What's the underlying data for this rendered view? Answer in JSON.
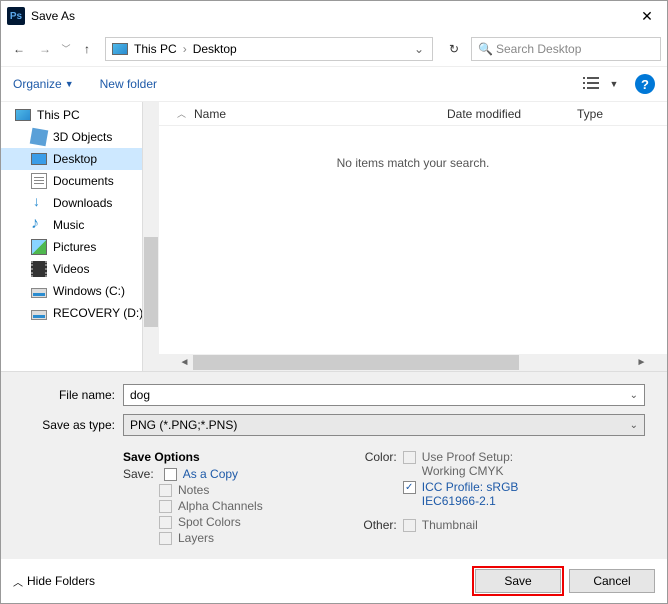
{
  "window": {
    "title": "Save As"
  },
  "breadcrumb": {
    "root": "This PC",
    "current": "Desktop"
  },
  "search": {
    "placeholder": "Search Desktop"
  },
  "toolbar": {
    "organize": "Organize",
    "new_folder": "New folder"
  },
  "tree": {
    "this_pc": "This PC",
    "objects_3d": "3D Objects",
    "desktop": "Desktop",
    "documents": "Documents",
    "downloads": "Downloads",
    "music": "Music",
    "pictures": "Pictures",
    "videos": "Videos",
    "drive_c": "Windows (C:)",
    "drive_d": "RECOVERY (D:)"
  },
  "columns": {
    "name": "Name",
    "date": "Date modified",
    "type": "Type"
  },
  "empty_message": "No items match your search.",
  "form": {
    "filename_label": "File name:",
    "filename_value": "dog",
    "type_label": "Save as type:",
    "type_value": "PNG (*.PNG;*.PNS)"
  },
  "options": {
    "heading": "Save Options",
    "save_label": "Save:",
    "as_copy": "As a Copy",
    "notes": "Notes",
    "alpha": "Alpha Channels",
    "spot": "Spot Colors",
    "layers": "Layers",
    "color_label": "Color:",
    "proof": "Use Proof Setup: Working CMYK",
    "icc": "ICC Profile:  sRGB IEC61966-2.1",
    "other_label": "Other:",
    "thumbnail": "Thumbnail"
  },
  "footer": {
    "hide_folders": "Hide Folders",
    "save": "Save",
    "cancel": "Cancel"
  }
}
